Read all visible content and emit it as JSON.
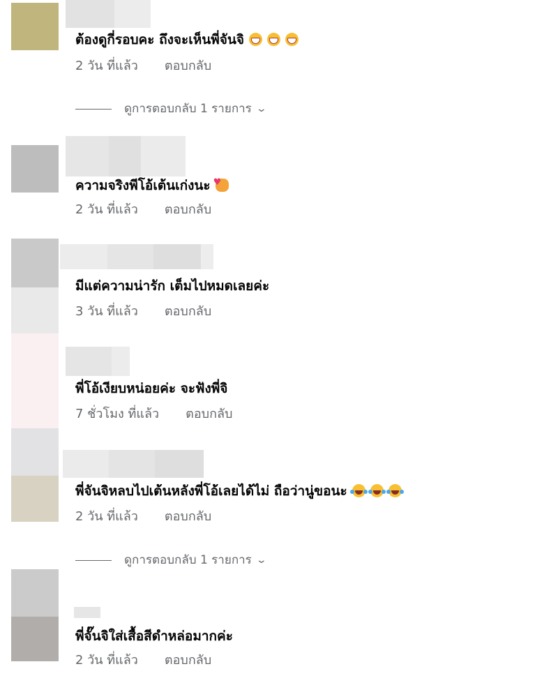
{
  "comments": [
    {
      "text": "ต้องดูกี่รอบคะ ถึงจะเห็นพี่จันจิ",
      "emojis": [
        "grinning-face-icon",
        "grinning-face-icon",
        "grinning-face-icon"
      ],
      "time": "2 วัน ที่แล้ว",
      "reply": "ตอบกลับ",
      "view_replies": "ดูการตอบกลับ 1 รายการ",
      "avatar_color": "#c1b57e"
    },
    {
      "text": "ความจริงพีโอ้เต้นเก่งนะ",
      "emojis": [
        "smiling-face-with-hearts-icon"
      ],
      "time": "2 วัน ที่แล้ว",
      "reply": "ตอบกลับ",
      "avatar_color": "#bdbdbd"
    },
    {
      "text": "มีแต่ความน่ารัก เต็มไปหมดเลยค่ะ",
      "emojis": [],
      "time": "3 วัน ที่แล้ว",
      "reply": "ตอบกลับ",
      "avatar_color": "#c9c9c9"
    },
    {
      "text": "พี่โอ้เงียบหน่อยค่ะ จะฟังพี่จิ",
      "emojis": [],
      "time": "7 ชั่วโมง ที่แล้ว",
      "reply": "ตอบกลับ",
      "avatar_color": "#faf0f1"
    },
    {
      "text": "พี่จันจิหลบไปเต้นหลังพี่โอ้เลยได้ไม่ ถือว่านู่ขอนะ",
      "emojis": [
        "face-with-tears-of-joy-icon",
        "face-with-tears-of-joy-icon",
        "face-with-tears-of-joy-icon"
      ],
      "time": "2 วัน ที่แล้ว",
      "reply": "ตอบกลับ",
      "view_replies": "ดูการตอบกลับ 1 รายการ",
      "avatar_color": "#d8d2c2"
    },
    {
      "text": "พี่จั๊นจิใส่เสื้อสีดำหล่อมากค่ะ",
      "emojis": [],
      "time": "2 วัน ที่แล้ว",
      "reply": "ตอบกลับ",
      "avatar_color": "#b1adaa"
    }
  ],
  "colors": {
    "text_primary": "#050505",
    "text_secondary": "#65676b",
    "emoji_yellow": "#f7c034"
  }
}
